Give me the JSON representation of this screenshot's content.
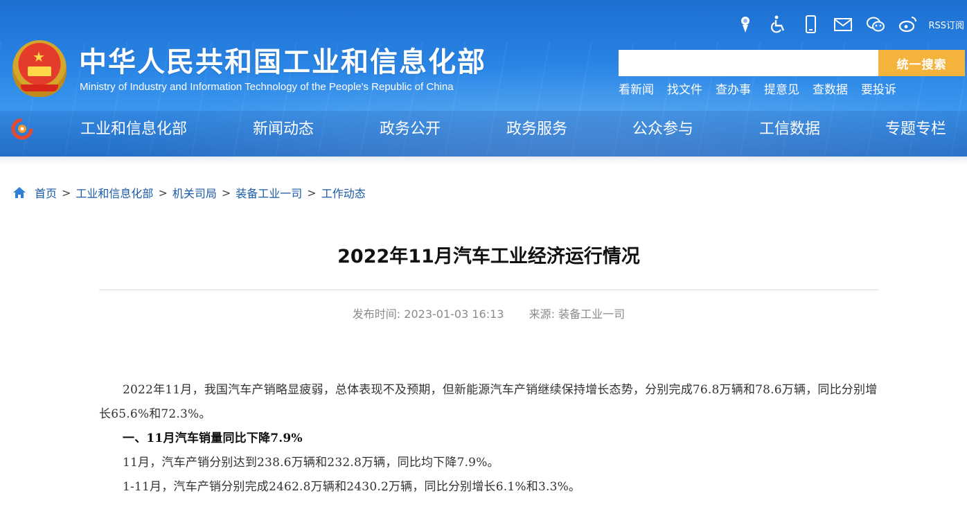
{
  "header": {
    "title": "中华人民共和国工业和信息化部",
    "subtitle": "Ministry of Industry and Information Technology of the People's Republic of China",
    "rss_label": "RSS订阅",
    "tool_icons": [
      "elderly-mode-icon",
      "accessibility-icon",
      "mobile-icon",
      "mail-icon",
      "wechat-icon",
      "weibo-icon"
    ],
    "search": {
      "placeholder": "",
      "button_label": "统一搜索"
    },
    "quick_links": [
      "看新闻",
      "找文件",
      "查办事",
      "提意见",
      "查数据",
      "要投诉"
    ],
    "accent_color": "#f4b43c",
    "header_color": "#2a86e6"
  },
  "nav": {
    "items": [
      "工业和信息化部",
      "新闻动态",
      "政务公开",
      "政务服务",
      "公众参与",
      "工信数据",
      "专题专栏"
    ]
  },
  "breadcrumb": {
    "items": [
      "首页",
      "工业和信息化部",
      "机关司局",
      "装备工业一司",
      "工作动态"
    ],
    "separator": ">"
  },
  "article": {
    "title": "2022年11月汽车工业经济运行情况",
    "publish_label": "发布时间:",
    "publish_time": "2023-01-03 16:13",
    "source_label": "来源:",
    "source": "装备工业一司",
    "paragraphs": [
      {
        "text": "2022年11月，我国汽车产销略显疲弱，总体表现不及预期，但新能源汽车产销继续保持增长态势，分别完成76.8万辆和78.6万辆，同比分别增长65.6%和72.3%。",
        "bold": false
      },
      {
        "text": "一、11月汽车销量同比下降7.9%",
        "bold": true
      },
      {
        "text": "11月，汽车产销分别达到238.6万辆和232.8万辆，同比均下降7.9%。",
        "bold": false
      },
      {
        "text": "1-11月，汽车产销分别完成2462.8万辆和2430.2万辆，同比分别增长6.1%和3.3%。",
        "bold": false
      }
    ]
  }
}
